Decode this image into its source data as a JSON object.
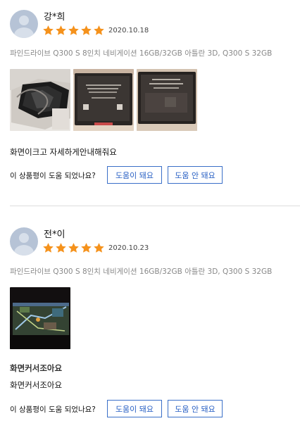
{
  "question_text": "이 상품평이 도움 되었나요?",
  "yes_label": "도움이 돼요",
  "no_label": "도움 안 돼요",
  "colors": {
    "star": "#f5921c",
    "button_border": "#3a6fc8",
    "button_text": "#2a61c4"
  },
  "reviews": [
    {
      "author": "강*희",
      "rating": 5,
      "date": "2020.10.18",
      "option": "파인드라이브 Q300 S 8인치 네비게이션 16GB/32GB 아틀란 3D, Q300 S 32GB",
      "photos": [
        "navigation-unit-photo",
        "navigation-screen-back-photo",
        "navigation-screen-film-photo"
      ],
      "title": "",
      "text": "화면이크고 자세하게안내해줘요"
    },
    {
      "author": "전*이",
      "rating": 5,
      "date": "2020.10.23",
      "option": "파인드라이브 Q300 S 8인치 네비게이션 16GB/32GB 아틀란 3D, Q300 S 32GB",
      "photos": [
        "navigation-map-screen-photo"
      ],
      "title": "화면커서조아요",
      "text": "화면커서조아요"
    }
  ]
}
